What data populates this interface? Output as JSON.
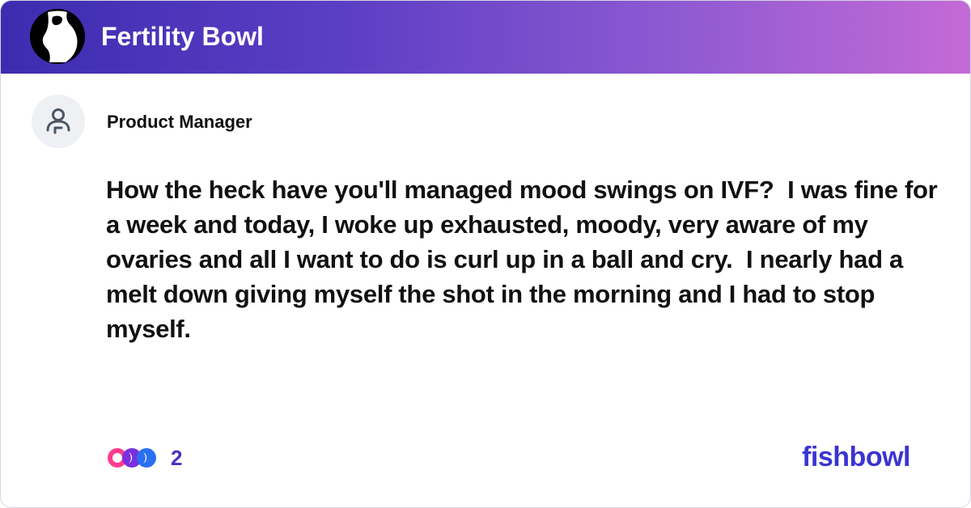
{
  "header": {
    "title": "Fertility Bowl",
    "logo_icon": "pregnant-silhouette-icon"
  },
  "post": {
    "author": "Product Manager",
    "avatar_icon": "user-avatar-icon",
    "text": "How the heck have you'll managed mood swings on IVF?  I was fine for a week and today, I woke up exhausted, moody, very aware of my ovaries and all I want to do is curl up in a ball and cry.  I nearly had a melt down giving myself the shot in the morning and I had to stop myself."
  },
  "footer": {
    "reaction_count": "2",
    "reaction_icons": [
      "reaction-pink-icon",
      "reaction-purple-icon",
      "reaction-blue-icon"
    ],
    "brand": "fishbowl"
  },
  "colors": {
    "header_start": "#3d2cb0",
    "header_end": "#c46ad6",
    "brand": "#3c34d2",
    "count": "#4a2fc4"
  }
}
